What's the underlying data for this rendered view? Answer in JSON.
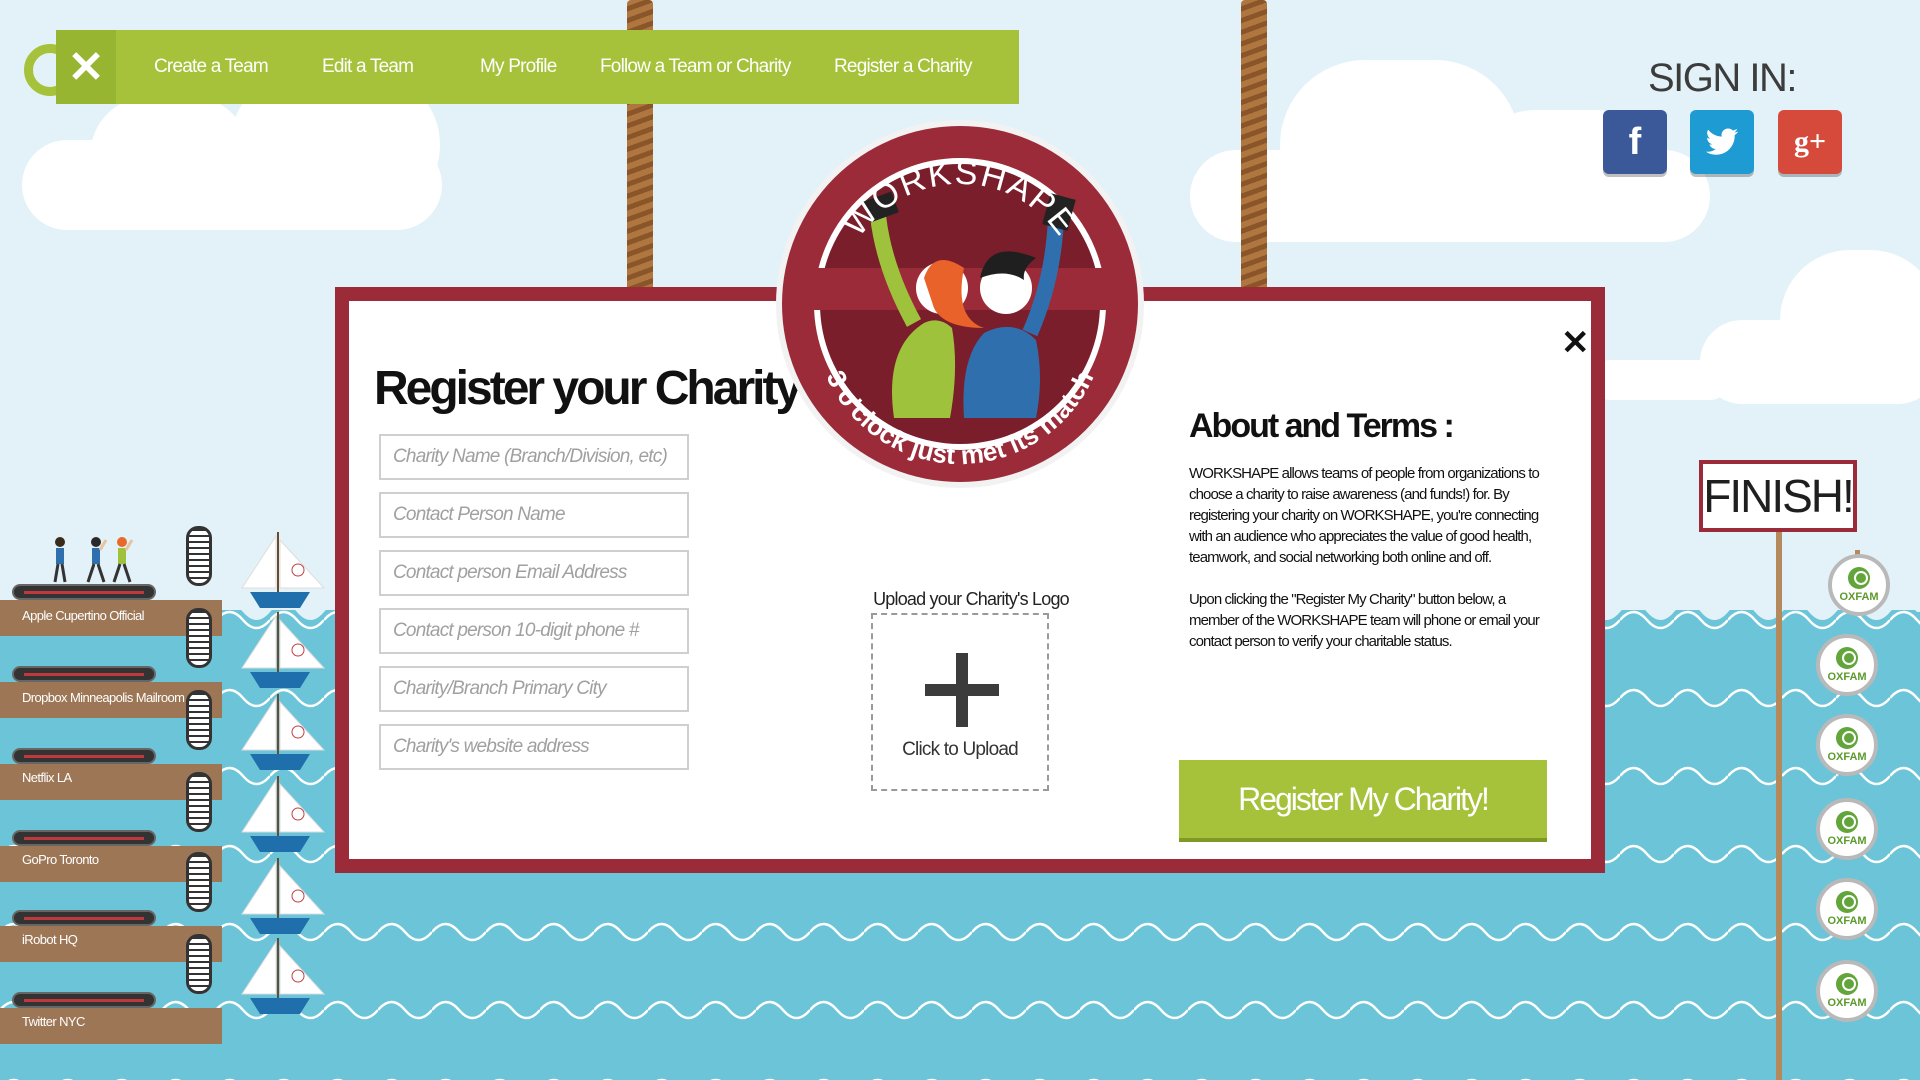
{
  "nav": {
    "close_icon": "close-icon",
    "items": [
      {
        "label": "Create a Team"
      },
      {
        "label": "Edit a Team"
      },
      {
        "label": "My Profile"
      },
      {
        "label": "Follow a Team or Charity"
      },
      {
        "label": "Register a Charity"
      }
    ]
  },
  "signin": {
    "title": "SIGN IN:",
    "providers": [
      {
        "icon": "facebook-icon",
        "glyph": "f"
      },
      {
        "icon": "twitter-icon",
        "glyph": "t"
      },
      {
        "icon": "google-plus-icon",
        "glyph": "g+"
      }
    ]
  },
  "badge": {
    "brand": "WORKSHAPE",
    "tagline": "3 o'clock just met its match"
  },
  "modal": {
    "title": "Register your Charity",
    "fields": [
      {
        "placeholder": "Charity Name (Branch/Division, etc)"
      },
      {
        "placeholder": "Contact Person Name"
      },
      {
        "placeholder": "Contact person Email Address"
      },
      {
        "placeholder": "Contact person 10-digit phone #"
      },
      {
        "placeholder": "Charity/Branch Primary City"
      },
      {
        "placeholder": "Charity's website address"
      }
    ],
    "upload": {
      "label": "Upload your Charity's Logo",
      "button_text": "Click to Upload"
    },
    "about": {
      "title": "About and Terms :",
      "paragraph1": "WORKSHAPE allows teams of people from organizations to choose a charity to raise awareness (and funds!) for. By registering your charity on WORKSHAPE, you're connecting with an audience who appreciates the value of good health, teamwork, and social networking both online and off.",
      "paragraph2": "Upon clicking the \"Register My Charity\" button below, a member of the WORKSHAPE team will phone or email your contact person to verify your charitable status."
    },
    "submit_label": "Register My Charity!"
  },
  "teams": [
    {
      "name": "Apple Cupertino Official"
    },
    {
      "name": "Dropbox Minneapolis Mailroom"
    },
    {
      "name": "Netflix LA"
    },
    {
      "name": "GoPro Toronto"
    },
    {
      "name": "iRobot HQ"
    },
    {
      "name": "Twitter NYC"
    }
  ],
  "finish": {
    "label": "FINISH!",
    "charity_badge": "OXFAM"
  },
  "colors": {
    "accent_green": "#a6c23b",
    "modal_border": "#9b2b39",
    "sea": "#6cc4d9",
    "sky": "#e3f2f8"
  }
}
